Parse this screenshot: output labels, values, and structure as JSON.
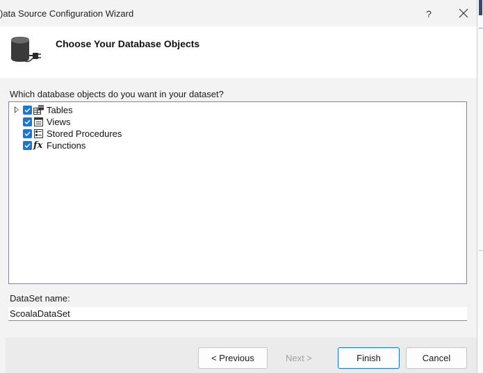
{
  "window": {
    "title": ")ata Source Configuration Wizard",
    "help_label": "?",
    "close_label": "✕"
  },
  "header": {
    "title": "Choose Your Database Objects",
    "icon": "database-connect-icon"
  },
  "question": "Which database objects do you want in your dataset?",
  "tree": {
    "items": [
      {
        "label": "Tables",
        "checked": true,
        "expandable": true,
        "icon": "tables-icon"
      },
      {
        "label": "Views",
        "checked": true,
        "expandable": false,
        "icon": "views-icon"
      },
      {
        "label": "Stored Procedures",
        "checked": true,
        "expandable": false,
        "icon": "stored-procedures-icon"
      },
      {
        "label": "Functions",
        "checked": true,
        "expandable": false,
        "icon": "functions-icon"
      }
    ],
    "function_glyph": "fx"
  },
  "dataset": {
    "label": "DataSet name:",
    "value": "ScoalaDataSet"
  },
  "buttons": {
    "previous": "< Previous",
    "next": "Next >",
    "finish": "Finish",
    "cancel": "Cancel"
  },
  "colors": {
    "checkbox": "#1976d2",
    "default_button_border": "#1a73e8",
    "dialog_bg": "#f3f3f3",
    "header_bg": "#ffffff"
  }
}
